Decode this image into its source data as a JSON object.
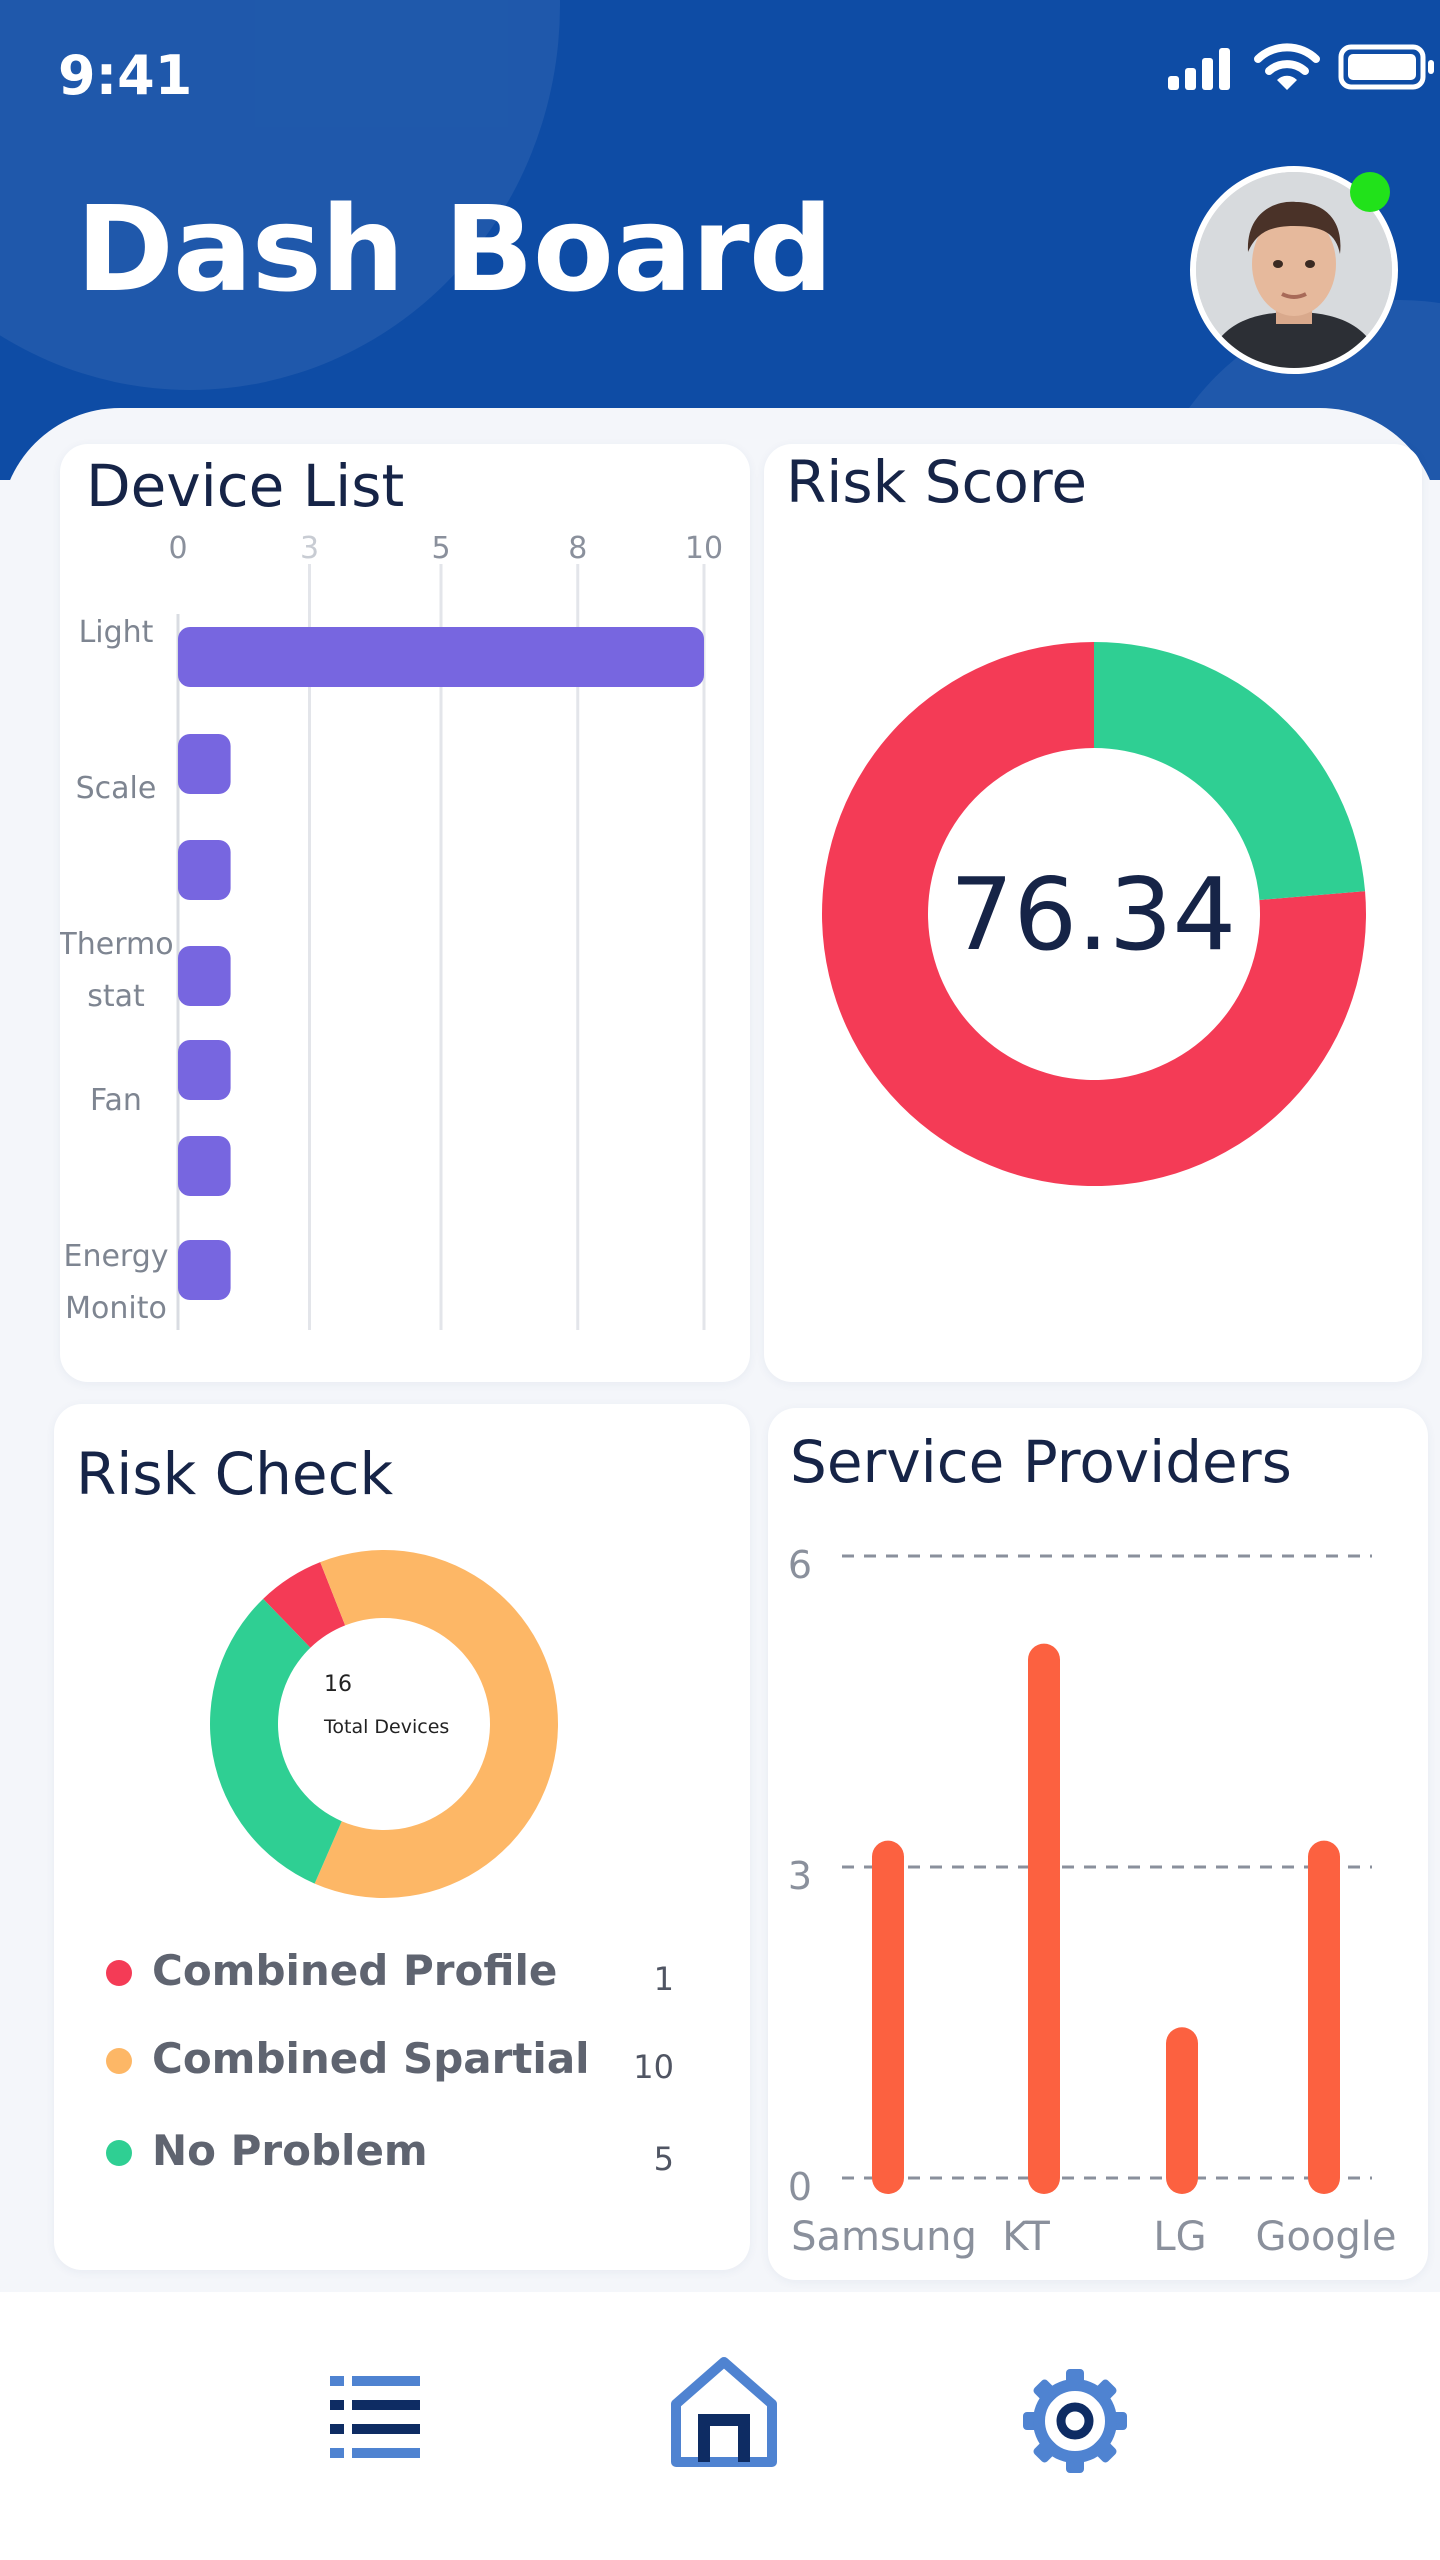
{
  "status_bar": {
    "time": "9:41"
  },
  "header": {
    "title": "Dash Board"
  },
  "colors": {
    "header_blue": "#0e4ca5",
    "bar_purple": "#7766e0",
    "risk_red": "#f43b56",
    "risk_green": "#2fcf93",
    "risk_orange": "#fdb766",
    "provider_bar": "#fc6140",
    "online_green": "#21e21a",
    "nav_icon": "#4f83d1",
    "nav_icon_dark": "#0e2c63"
  },
  "device_list": {
    "title": "Device List",
    "chart_data": {
      "type": "bar",
      "orientation": "horizontal",
      "x_ticks": [
        "0",
        "3",
        "5",
        "8",
        "10"
      ],
      "xlim": [
        0,
        10
      ],
      "category_labels": [
        "Light",
        "Scale",
        "Thermo stat",
        "Fan",
        "Energy Monito"
      ],
      "values": [
        10,
        1,
        1,
        1,
        1,
        1,
        1
      ],
      "grid": true
    }
  },
  "risk_score": {
    "title": "Risk Score",
    "value": "76.34",
    "chart_data": {
      "type": "pie",
      "donut": true,
      "values": [
        76.34,
        23.66
      ],
      "colors": [
        "#f43b56",
        "#2fcf93"
      ]
    }
  },
  "risk_check": {
    "title": "Risk Check",
    "center_value": "16",
    "center_label": "Total Devices",
    "chart_data": {
      "type": "pie",
      "donut": true,
      "categories": [
        "Combined Profile",
        "Combined Spartial",
        "No Problem"
      ],
      "values": [
        1,
        10,
        5
      ],
      "colors": [
        "#f43b56",
        "#fdb766",
        "#2fcf93"
      ]
    },
    "legend": [
      {
        "label": "Combined Profile",
        "count": "1",
        "color": "#f43b56"
      },
      {
        "label": "Combined Spartial",
        "count": "10",
        "color": "#fdb766"
      },
      {
        "label": "No Problem",
        "count": "5",
        "color": "#2fcf93"
      }
    ]
  },
  "service_providers": {
    "title": "Service Providers",
    "chart_data": {
      "type": "bar",
      "categories": [
        "Samsung",
        "KT",
        "LG",
        "Google"
      ],
      "values": [
        3.1,
        5,
        1.3,
        3.1
      ],
      "y_ticks": [
        "0",
        "3",
        "6"
      ],
      "ylim": [
        0,
        6
      ],
      "grid": true
    }
  },
  "nav": {
    "items": [
      {
        "name": "list-icon"
      },
      {
        "name": "home-icon"
      },
      {
        "name": "settings-icon"
      }
    ]
  }
}
